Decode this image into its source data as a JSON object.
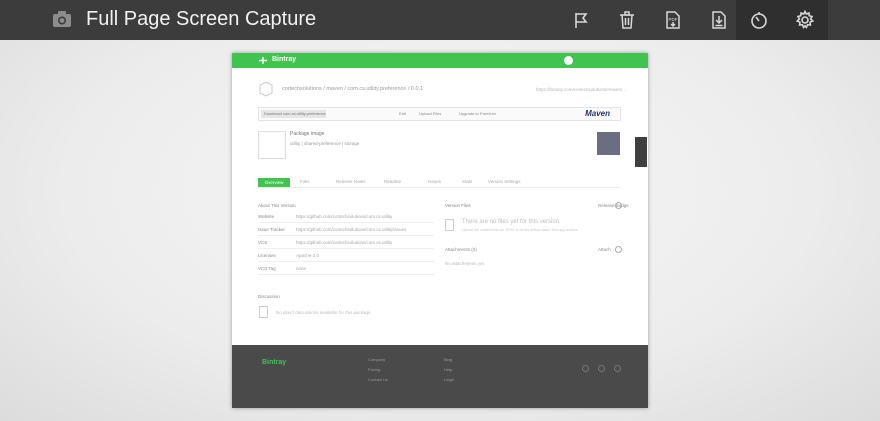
{
  "toolbar": {
    "title": "Full Page Screen Capture",
    "buttons": [
      {
        "icon": "flag-icon"
      },
      {
        "icon": "trash-icon"
      },
      {
        "icon": "pdf-download-icon"
      },
      {
        "icon": "image-download-icon"
      },
      {
        "icon": "timer-icon"
      },
      {
        "icon": "gear-icon"
      }
    ]
  },
  "preview": {
    "header_brand": "Bintray",
    "breadcrumb": "cortechsolutions / maven / com.cs.utility.preference / 0.0.1",
    "breadcrumb_url": "https://bintray.com/cortechsolutions/maven/...",
    "download_chip": "Download  com.cs.utility.preference",
    "download_links": [
      "Edit",
      "Upload Files",
      "Upgrade to Premium"
    ],
    "maven_logo": "Maven",
    "package_title": "Package image",
    "package_sub": "utility  |  shared-preference  |  storage",
    "tabs": [
      "Overview",
      "Files",
      "Release Notes",
      "Readme",
      "Issues",
      "Stats",
      "Version Settings"
    ],
    "about_title": "About This Version",
    "about_rows": [
      {
        "k": "Website",
        "v": "https://github.com/cortechsolutions/com.cs.utility"
      },
      {
        "k": "Issue Tracker",
        "v": "https://github.com/cortechsolutions/com.cs.utility/issues"
      },
      {
        "k": "VCS",
        "v": "https://github.com/cortechsolutions/com.cs.utility"
      },
      {
        "k": "Licenses",
        "v": "Apache-2.0"
      },
      {
        "k": "VCS Tag",
        "v": "none"
      }
    ],
    "recent_files_title": "Version Files",
    "release_badge": "Release Badge",
    "no_files": "There are no files yet for this version.",
    "no_files_sub": "Upload the content from an SPDX to do the artifact faster from app actions.",
    "attachments_title": "Attachments (0)",
    "attach_label": "Attach",
    "attachments_empty": "No attachments yet.",
    "discussion_title": "Discussion",
    "discussion_text": "No direct discussions available for this package.",
    "footer_logo": "Bintray",
    "footer_cols": [
      [
        "Company",
        "Pricing",
        "Contact Us"
      ],
      [
        "Blog",
        "Help",
        "Legal"
      ]
    ]
  },
  "colors": {
    "toolbar_bg": "#3c3c3c",
    "accent_green": "#41c34f",
    "footer_bg": "#4a4a4a"
  }
}
